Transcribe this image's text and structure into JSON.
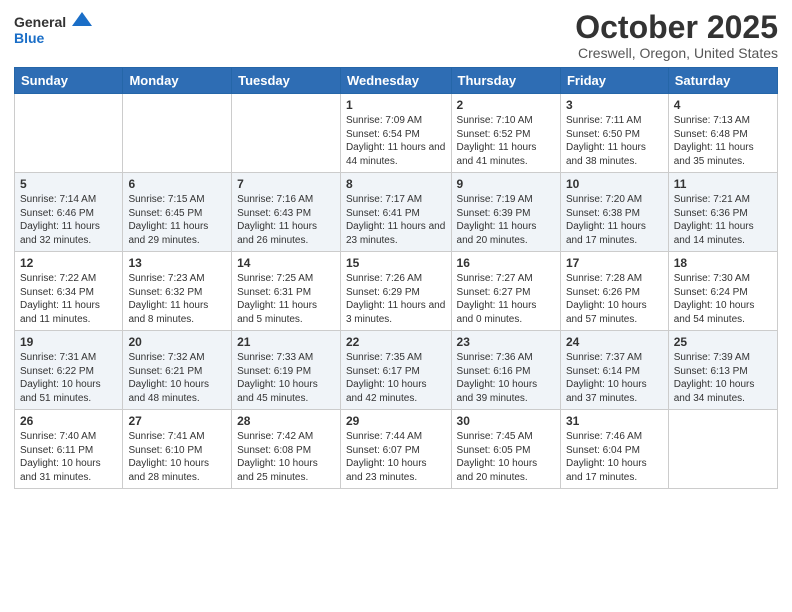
{
  "header": {
    "logo_general": "General",
    "logo_blue": "Blue",
    "month_title": "October 2025",
    "location": "Creswell, Oregon, United States"
  },
  "days_of_week": [
    "Sunday",
    "Monday",
    "Tuesday",
    "Wednesday",
    "Thursday",
    "Friday",
    "Saturday"
  ],
  "weeks": [
    {
      "days": [
        {
          "number": "",
          "info": ""
        },
        {
          "number": "",
          "info": ""
        },
        {
          "number": "",
          "info": ""
        },
        {
          "number": "1",
          "info": "Sunrise: 7:09 AM\nSunset: 6:54 PM\nDaylight: 11 hours and 44 minutes."
        },
        {
          "number": "2",
          "info": "Sunrise: 7:10 AM\nSunset: 6:52 PM\nDaylight: 11 hours and 41 minutes."
        },
        {
          "number": "3",
          "info": "Sunrise: 7:11 AM\nSunset: 6:50 PM\nDaylight: 11 hours and 38 minutes."
        },
        {
          "number": "4",
          "info": "Sunrise: 7:13 AM\nSunset: 6:48 PM\nDaylight: 11 hours and 35 minutes."
        }
      ]
    },
    {
      "days": [
        {
          "number": "5",
          "info": "Sunrise: 7:14 AM\nSunset: 6:46 PM\nDaylight: 11 hours and 32 minutes."
        },
        {
          "number": "6",
          "info": "Sunrise: 7:15 AM\nSunset: 6:45 PM\nDaylight: 11 hours and 29 minutes."
        },
        {
          "number": "7",
          "info": "Sunrise: 7:16 AM\nSunset: 6:43 PM\nDaylight: 11 hours and 26 minutes."
        },
        {
          "number": "8",
          "info": "Sunrise: 7:17 AM\nSunset: 6:41 PM\nDaylight: 11 hours and 23 minutes."
        },
        {
          "number": "9",
          "info": "Sunrise: 7:19 AM\nSunset: 6:39 PM\nDaylight: 11 hours and 20 minutes."
        },
        {
          "number": "10",
          "info": "Sunrise: 7:20 AM\nSunset: 6:38 PM\nDaylight: 11 hours and 17 minutes."
        },
        {
          "number": "11",
          "info": "Sunrise: 7:21 AM\nSunset: 6:36 PM\nDaylight: 11 hours and 14 minutes."
        }
      ]
    },
    {
      "days": [
        {
          "number": "12",
          "info": "Sunrise: 7:22 AM\nSunset: 6:34 PM\nDaylight: 11 hours and 11 minutes."
        },
        {
          "number": "13",
          "info": "Sunrise: 7:23 AM\nSunset: 6:32 PM\nDaylight: 11 hours and 8 minutes."
        },
        {
          "number": "14",
          "info": "Sunrise: 7:25 AM\nSunset: 6:31 PM\nDaylight: 11 hours and 5 minutes."
        },
        {
          "number": "15",
          "info": "Sunrise: 7:26 AM\nSunset: 6:29 PM\nDaylight: 11 hours and 3 minutes."
        },
        {
          "number": "16",
          "info": "Sunrise: 7:27 AM\nSunset: 6:27 PM\nDaylight: 11 hours and 0 minutes."
        },
        {
          "number": "17",
          "info": "Sunrise: 7:28 AM\nSunset: 6:26 PM\nDaylight: 10 hours and 57 minutes."
        },
        {
          "number": "18",
          "info": "Sunrise: 7:30 AM\nSunset: 6:24 PM\nDaylight: 10 hours and 54 minutes."
        }
      ]
    },
    {
      "days": [
        {
          "number": "19",
          "info": "Sunrise: 7:31 AM\nSunset: 6:22 PM\nDaylight: 10 hours and 51 minutes."
        },
        {
          "number": "20",
          "info": "Sunrise: 7:32 AM\nSunset: 6:21 PM\nDaylight: 10 hours and 48 minutes."
        },
        {
          "number": "21",
          "info": "Sunrise: 7:33 AM\nSunset: 6:19 PM\nDaylight: 10 hours and 45 minutes."
        },
        {
          "number": "22",
          "info": "Sunrise: 7:35 AM\nSunset: 6:17 PM\nDaylight: 10 hours and 42 minutes."
        },
        {
          "number": "23",
          "info": "Sunrise: 7:36 AM\nSunset: 6:16 PM\nDaylight: 10 hours and 39 minutes."
        },
        {
          "number": "24",
          "info": "Sunrise: 7:37 AM\nSunset: 6:14 PM\nDaylight: 10 hours and 37 minutes."
        },
        {
          "number": "25",
          "info": "Sunrise: 7:39 AM\nSunset: 6:13 PM\nDaylight: 10 hours and 34 minutes."
        }
      ]
    },
    {
      "days": [
        {
          "number": "26",
          "info": "Sunrise: 7:40 AM\nSunset: 6:11 PM\nDaylight: 10 hours and 31 minutes."
        },
        {
          "number": "27",
          "info": "Sunrise: 7:41 AM\nSunset: 6:10 PM\nDaylight: 10 hours and 28 minutes."
        },
        {
          "number": "28",
          "info": "Sunrise: 7:42 AM\nSunset: 6:08 PM\nDaylight: 10 hours and 25 minutes."
        },
        {
          "number": "29",
          "info": "Sunrise: 7:44 AM\nSunset: 6:07 PM\nDaylight: 10 hours and 23 minutes."
        },
        {
          "number": "30",
          "info": "Sunrise: 7:45 AM\nSunset: 6:05 PM\nDaylight: 10 hours and 20 minutes."
        },
        {
          "number": "31",
          "info": "Sunrise: 7:46 AM\nSunset: 6:04 PM\nDaylight: 10 hours and 17 minutes."
        },
        {
          "number": "",
          "info": ""
        }
      ]
    }
  ]
}
